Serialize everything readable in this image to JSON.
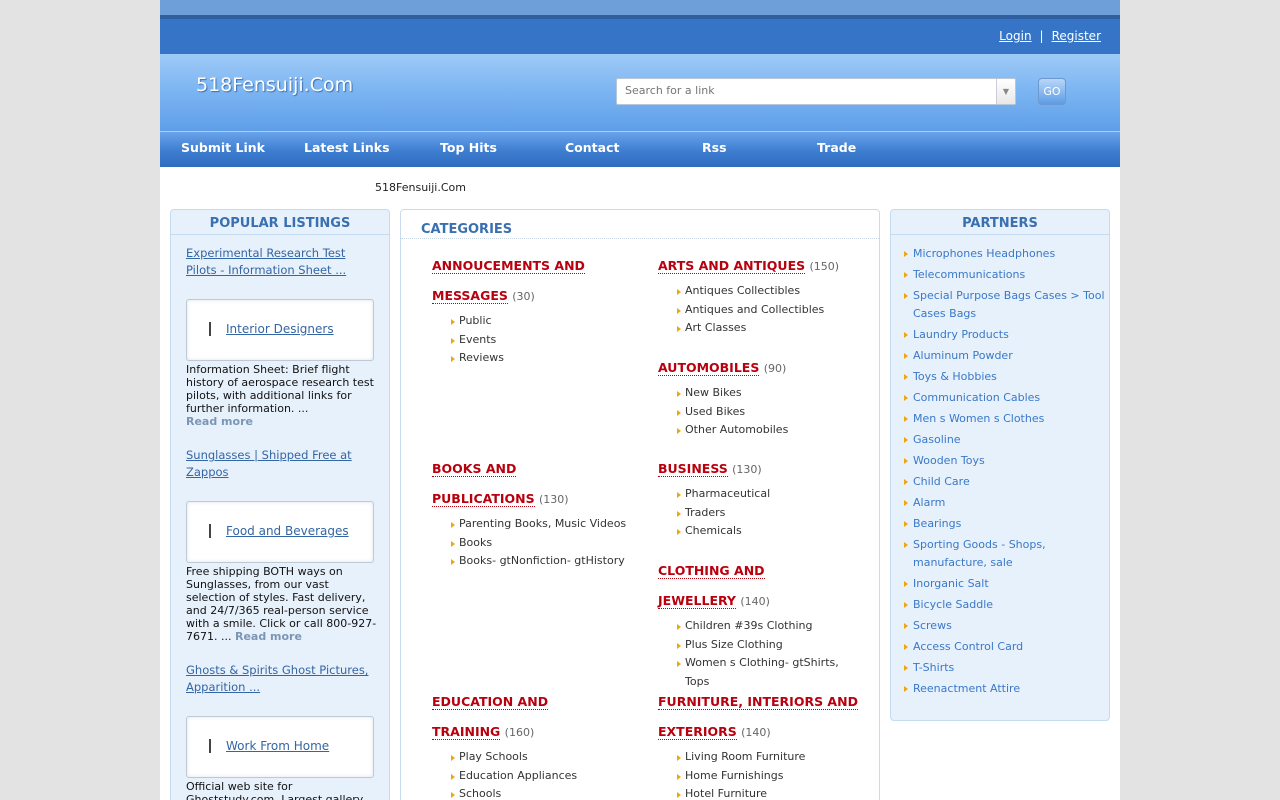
{
  "header": {
    "login": "Login",
    "separator": "|",
    "register": "Register",
    "logo": "518Fensuiji.Com",
    "search_placeholder": "Search for a link",
    "go": "GO"
  },
  "nav": [
    "Submit Link",
    "Latest Links",
    "Top Hits",
    "Contact",
    "Rss",
    "Trade"
  ],
  "site_title": "518Fensuiji.Com",
  "popular": {
    "heading": "POPULAR LISTINGS",
    "items": [
      {
        "link": "Experimental Research Test Pilots - Information Sheet ...",
        "box_title": "Interior Designers",
        "desc": "Information Sheet: Brief flight history of aerospace research test pilots, with additional links for further information. ...",
        "read_more": "Read more"
      },
      {
        "link": "Sunglasses | Shipped Free at Zappos",
        "box_title": "Food and Beverages",
        "desc": "Free shipping BOTH ways on Sunglasses, from our vast selection of styles. Fast delivery, and 24/7/365 real-person service with a smile. Click or call 800-927-7671. ...",
        "read_more": "Read more"
      },
      {
        "link": "Ghosts & Spirits Ghost Pictures, Apparition ...",
        "box_title": "Work From Home",
        "desc": "Official web site for Ghoststudy.com. Largest gallery"
      }
    ]
  },
  "categories": {
    "heading": "CATEGORIES",
    "items": [
      {
        "line1": "ANNOUCEMENTS AND",
        "line2": "MESSAGES",
        "count": "(30)",
        "subs": [
          "Public",
          "Events",
          "Reviews"
        ]
      },
      {
        "line1": "ARTS AND ANTIQUES",
        "count": "(150)",
        "subs": [
          "Antiques Collectibles",
          "Antiques and Collectibles",
          "Art Classes"
        ]
      },
      {
        "line1": "AUTOMOBILES",
        "count": "(90)",
        "subs": [
          "New Bikes",
          "Used Bikes",
          "Other Automobiles"
        ]
      },
      {
        "line1": "BOOKS AND",
        "line2": "PUBLICATIONS",
        "count": "(130)",
        "subs": [
          "Parenting Books, Music Videos",
          "Books",
          "Books- gtNonfiction- gtHistory"
        ]
      },
      {
        "line1": "BUSINESS",
        "count": "(130)",
        "subs": [
          "Pharmaceutical",
          "Traders",
          "Chemicals"
        ]
      },
      {
        "line1": "CLOTHING AND",
        "line2": "JEWELLERY",
        "count": "(140)",
        "subs": [
          "Children #39s Clothing",
          "Plus Size Clothing",
          "Women s Clothing- gtShirts, Tops"
        ]
      },
      {
        "line1": "EDUCATION AND",
        "line2": "TRAINING",
        "count": "(160)",
        "subs": [
          "Play Schools",
          "Education Appliances",
          "Schools"
        ]
      },
      {
        "line1": "FURNITURE, INTERIORS AND",
        "line2": "EXTERIORS",
        "count": "(140)",
        "subs": [
          "Living Room Furniture",
          "Home Furnishings",
          "Hotel Furniture"
        ]
      }
    ]
  },
  "partners": {
    "heading": "PARTNERS",
    "items": [
      "Microphones Headphones",
      "Telecommunications",
      "Special Purpose Bags Cases > Tool Cases Bags",
      "Laundry Products",
      "Aluminum Powder",
      "Toys & Hobbies",
      "Communication Cables",
      "Men s Women s Clothes",
      "Gasoline",
      "Wooden Toys",
      "Child Care",
      "Alarm",
      "Bearings",
      "Sporting Goods - Shops, manufacture, sale",
      "Inorganic Salt",
      "Bicycle Saddle",
      "Screws",
      "Access Control Card",
      "T-Shirts",
      "Reenactment Attire"
    ]
  },
  "colors": {
    "brand_blue": "#3574c6",
    "category_red": "#b8000e",
    "panel_bg": "#e7f1fc",
    "bullet_orange": "#f0a50e"
  }
}
